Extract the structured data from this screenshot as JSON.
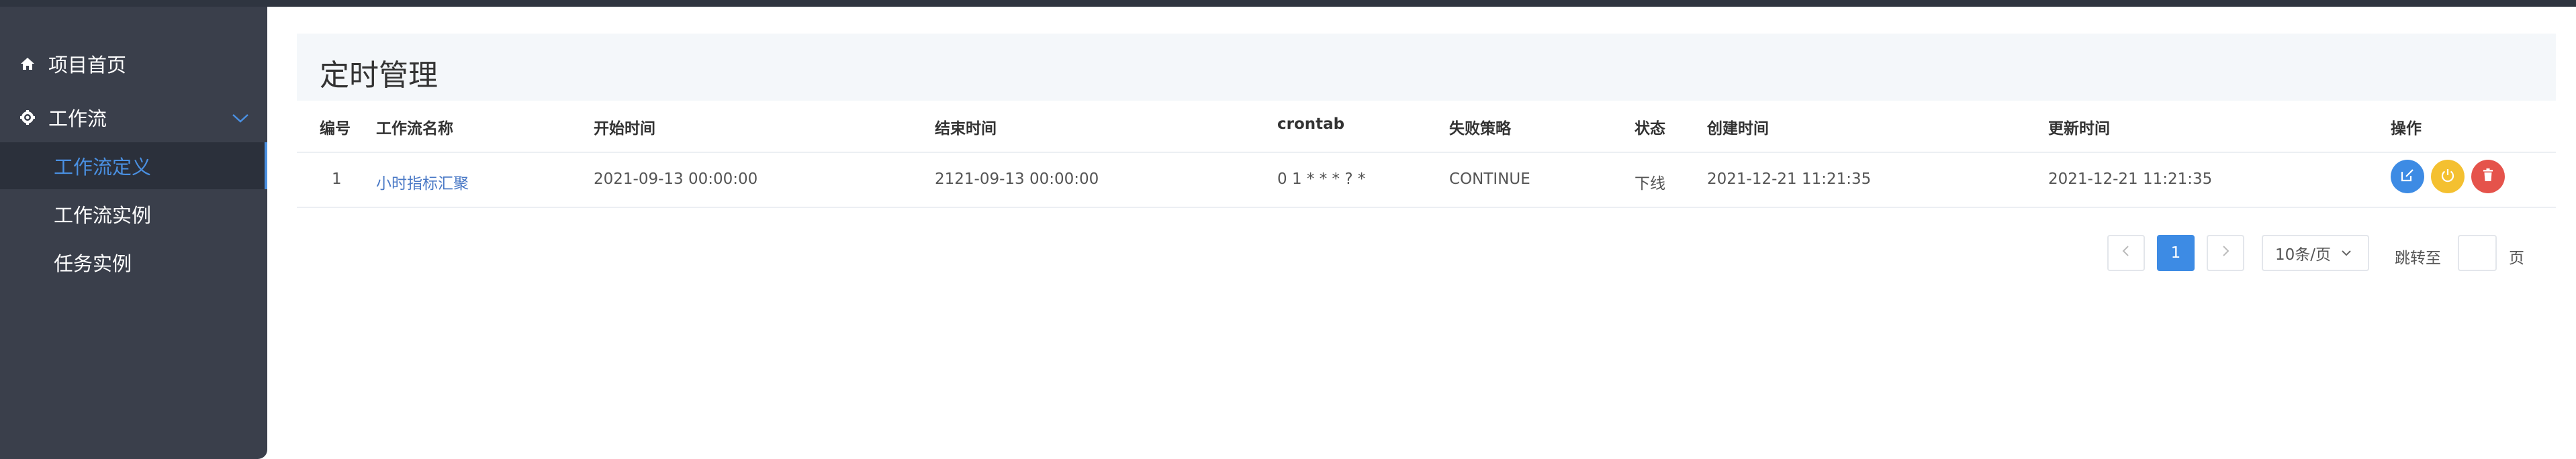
{
  "sidebar": {
    "home_label": "项目首页",
    "workflow_label": "工作流",
    "items": [
      {
        "label": "工作流定义"
      },
      {
        "label": "工作流实例"
      },
      {
        "label": "任务实例"
      }
    ]
  },
  "page": {
    "title": "定时管理"
  },
  "table": {
    "headers": [
      "编号",
      "工作流名称",
      "开始时间",
      "结束时间",
      "crontab",
      "失败策略",
      "状态",
      "创建时间",
      "更新时间",
      "操作"
    ],
    "rows": [
      {
        "id": "1",
        "name": "小时指标汇聚",
        "start": "2021-09-13 00:00:00",
        "end": "2121-09-13 00:00:00",
        "crontab": "0 1 * * * ? *",
        "strategy": "CONTINUE",
        "status": "下线",
        "created": "2021-12-21 11:21:35",
        "updated": "2021-12-21 11:21:35"
      }
    ]
  },
  "pagination": {
    "current": "1",
    "page_size": "10条/页",
    "jump_label": "跳转至",
    "jump_value": "",
    "page_suffix": "页"
  },
  "colors": {
    "accent": "#4a90e2",
    "edit_button": "#3d8be4",
    "power_button": "#f4c030",
    "delete_button": "#e5534b"
  }
}
